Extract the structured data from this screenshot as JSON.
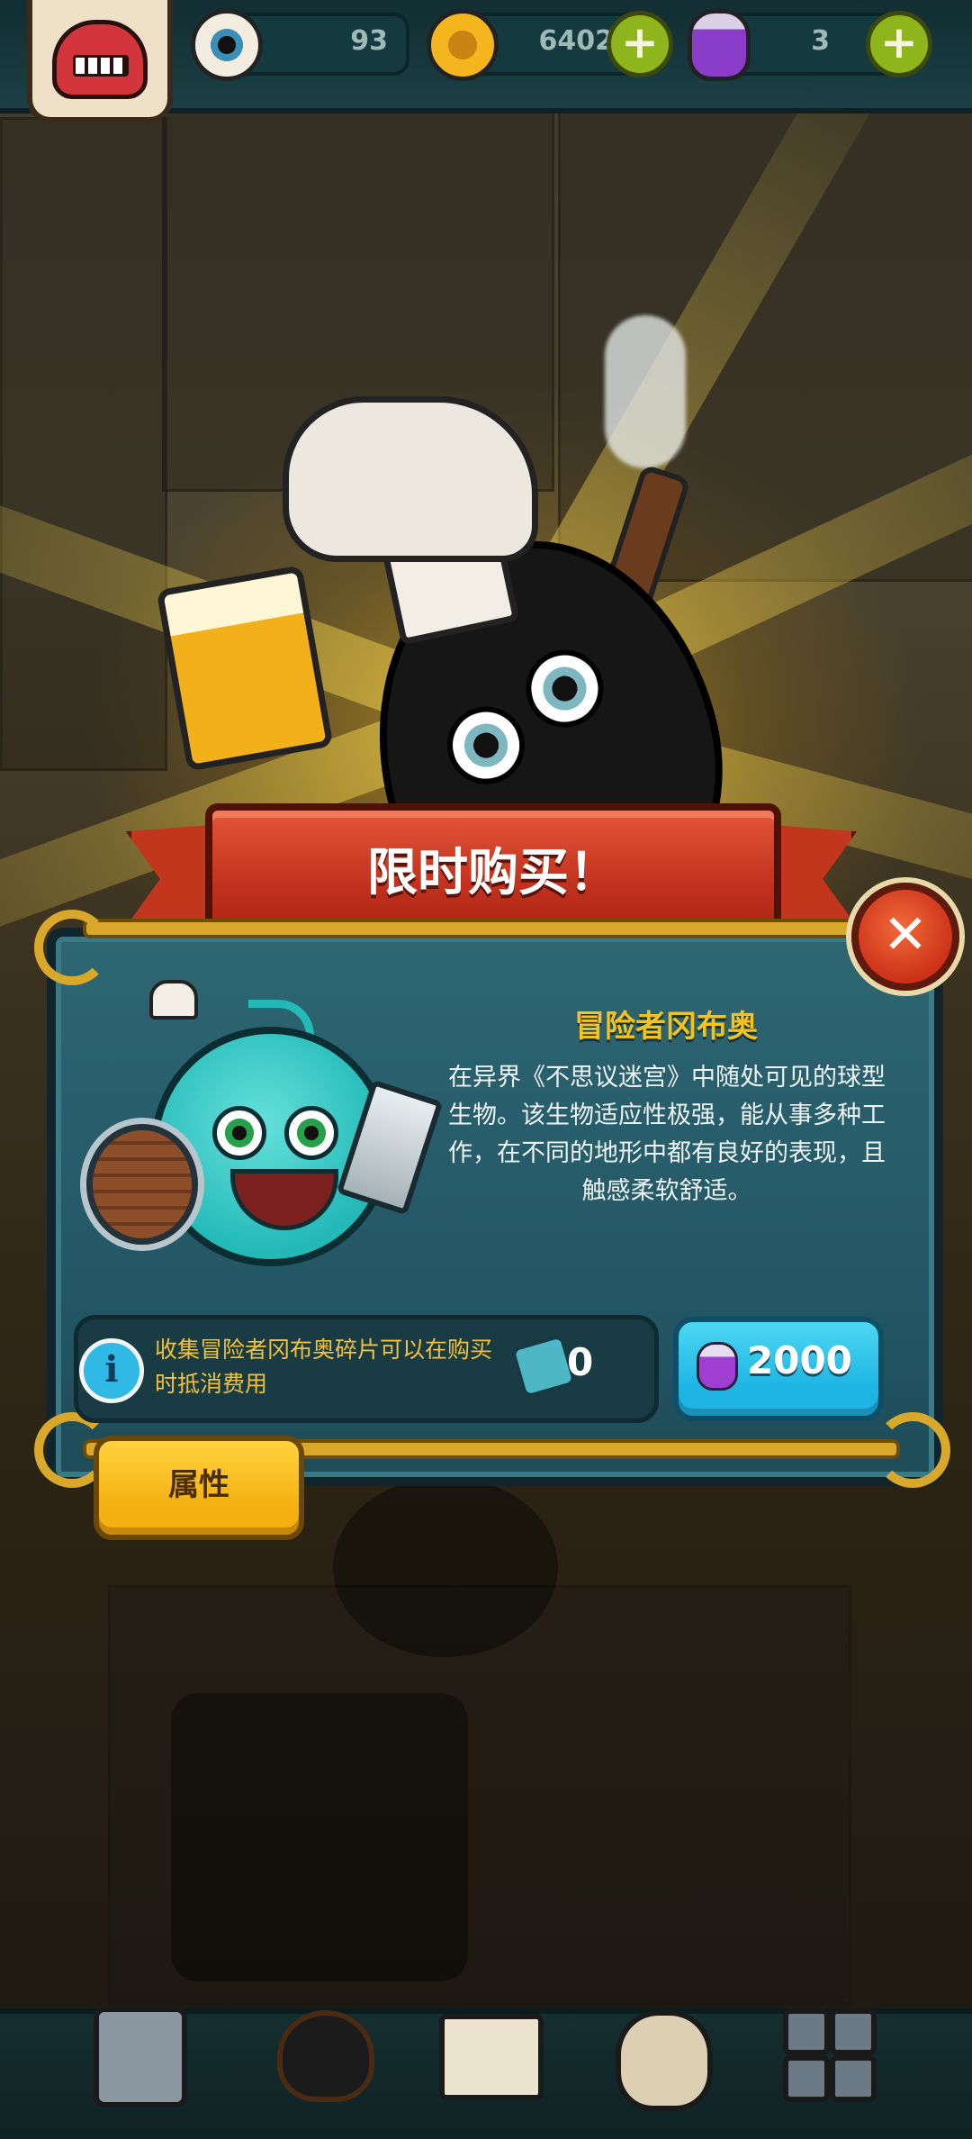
{
  "resources": {
    "eyes": {
      "icon": "eyeball-icon",
      "value": "93"
    },
    "coins": {
      "icon": "coin-icon",
      "value": "6402"
    },
    "potions": {
      "icon": "potion-icon",
      "value": "3"
    }
  },
  "banner": {
    "title": "限时购买！"
  },
  "offer": {
    "name": "冒险者冈布奥",
    "description": "在异界《不思议迷宫》中随处可见的球型生物。该生物适应性极强，能从事多种工作，在不同的地形中都有良好的表现，且触感柔软舒适。",
    "info_icon": "i",
    "info_text": "收集冒险者冈布奥碎片可以在购买时抵消费用",
    "shard_count": "0",
    "price": "2000",
    "price_icon": "potion-icon",
    "close_label": "✕"
  },
  "tabs": {
    "attributes": "属性"
  },
  "bottom_nav": [
    {
      "name": "nav-base",
      "icon": "machine-icon"
    },
    {
      "name": "nav-monsters",
      "icon": "monster-icon"
    },
    {
      "name": "nav-book",
      "icon": "book-icon"
    },
    {
      "name": "nav-bag",
      "icon": "bag-icon"
    },
    {
      "name": "nav-grid",
      "icon": "grid-icon"
    }
  ],
  "colors": {
    "title_yellow": "#f6c21c",
    "panel_teal": "#2e6672",
    "buy_button": "#1eb4e3",
    "attr_tab": "#f4b111",
    "close_button": "#cc3218"
  }
}
